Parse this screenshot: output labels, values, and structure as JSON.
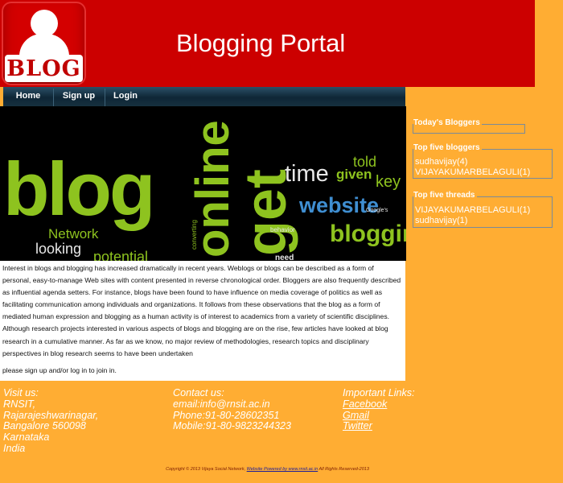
{
  "header": {
    "logo_text": "BLOG",
    "title": "Blogging Portal"
  },
  "nav": {
    "items": [
      {
        "label": "Home"
      },
      {
        "label": "Sign up"
      },
      {
        "label": "Login"
      }
    ]
  },
  "hero": {
    "words": [
      "blog",
      "online",
      "get",
      "time",
      "given",
      "told",
      "key",
      "website",
      "blogging",
      "Network",
      "looking",
      "potential",
      "converting",
      "behavior",
      "Google's",
      "need"
    ]
  },
  "main": {
    "intro": "Interest in blogs and blogging has increased dramatically in recent years. Weblogs or blogs can be described as a form of personal, easy-to-manage Web sites with content presented in reverse chronological order. Bloggers are also frequently described as influential agenda setters. For instance, blogs have been found to have influence on media coverage of politics as well as facilitating communication among individuals and organizations. It follows from these observations that the blog as a form of mediated human expression and blogging as a human activity is of interest to academics from a variety of scientific disciplines. Although research projects interested in various aspects of blogs and blogging are on the rise, few articles have looked at blog research in a cumulative manner. As far as we know, no major review of methodologies, research topics and disciplinary perspectives in blog research seems to have been undertaken",
    "join_text": "please sign up and/or log in to join in."
  },
  "sidebar": {
    "todays_bloggers": {
      "title": "Today's Bloggers",
      "entries": []
    },
    "top_bloggers": {
      "title": "Top five bloggers",
      "entries": [
        "sudhavijay(4)",
        "VIJAYAKUMARBELAGULI(1)"
      ]
    },
    "top_threads": {
      "title": "Top five threads",
      "entries": [
        "VIJAYAKUMARBELAGULI(1)",
        "sudhavijay(1)"
      ]
    }
  },
  "footer": {
    "visit": {
      "title": "Visit us:",
      "lines": [
        "RNSIT,",
        "Rajarajeshwarinagar,",
        "Bangalore 560098",
        "Karnataka",
        "India"
      ]
    },
    "contact": {
      "title": "Contact us:",
      "lines": [
        "email:info@rnsit.ac.in",
        "Phone:91-80-28602351",
        "Mobile:91-80-9823244323"
      ]
    },
    "links": {
      "title": "Important Links:",
      "items": [
        "Facebook",
        "Gmail",
        "Twitter"
      ]
    },
    "copyright_prefix": "Copyright © 2013 Vijaya Social Network, ",
    "copyright_link": "Website Powered by www.rnsit.ac.in",
    "copyright_suffix": " All Rights Reserved-2013"
  },
  "colors": {
    "page_background": "#ffad33",
    "header_red": "#cc0000",
    "nav_dark": "#0e2636",
    "hero_green": "#8ec31f",
    "hero_blue": "#3f8ed1"
  }
}
